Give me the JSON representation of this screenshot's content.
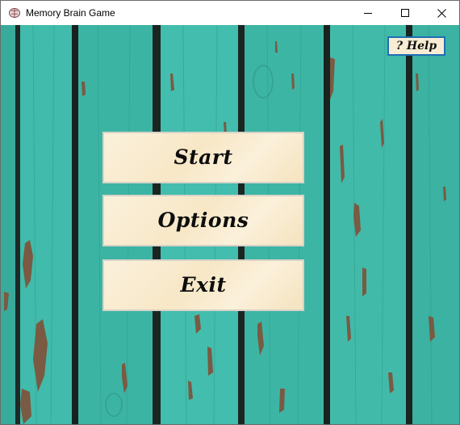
{
  "window": {
    "title": "Memory Brain Game",
    "icons": {
      "app": "brain-icon",
      "minimize": "minimize-icon",
      "maximize": "maximize-icon",
      "close": "close-icon"
    }
  },
  "menu": {
    "start_label": "Start",
    "options_label": "Options",
    "exit_label": "Exit"
  },
  "help": {
    "label": "? Help"
  },
  "colors": {
    "background_teal": "#3fb8a8",
    "button_cream": "#f8edd4",
    "help_border": "#1f6fb5",
    "wood_gap": "#1d2a26",
    "peeled_wood": "#7a5a42"
  }
}
